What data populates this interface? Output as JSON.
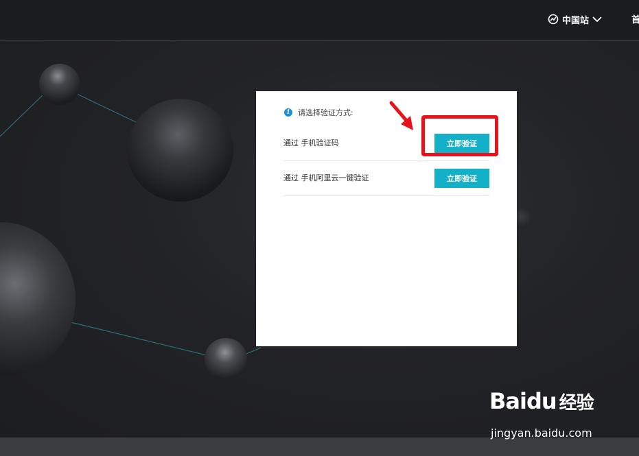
{
  "header": {
    "region_label": "中国站",
    "home_label": "首页"
  },
  "panel": {
    "prompt": "请选择验证方式:",
    "options": [
      {
        "label": "通过 手机验证码",
        "button": "立即验证"
      },
      {
        "label": "通过 手机阿里云一键验证",
        "button": "立即验证"
      }
    ]
  },
  "annotation": {
    "highlight_color": "#e8121b"
  },
  "watermark": {
    "brand": "Bai",
    "brand_paw": "du",
    "brand_cn": "经验",
    "url": "jingyan.baidu.com"
  },
  "colors": {
    "button": "#14b0c8",
    "info_icon": "#1e90d6",
    "topbar": "#1b1c1e"
  }
}
